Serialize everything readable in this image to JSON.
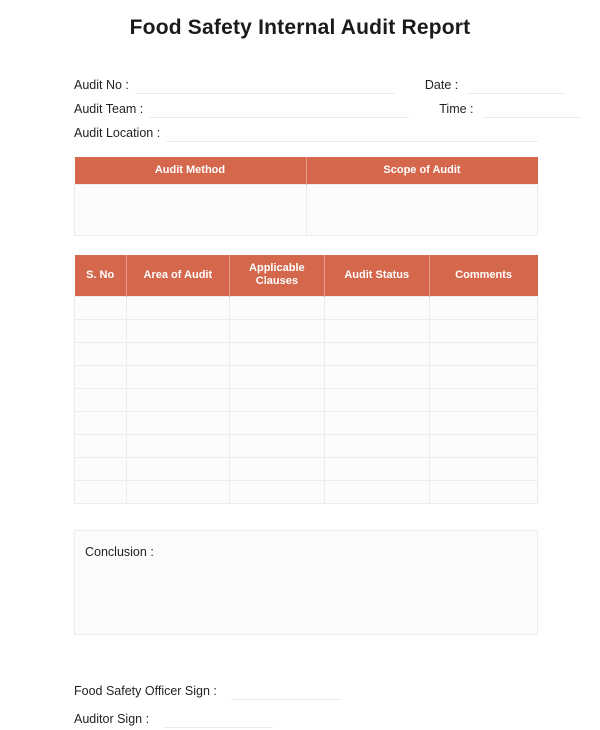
{
  "document": {
    "title": "Food Safety Internal Audit Report"
  },
  "meta": {
    "audit_no_label": "Audit No :",
    "audit_team_label": "Audit Team :",
    "audit_location_label": "Audit Location :",
    "date_label": "Date :",
    "time_label": "Time :",
    "audit_no_value": "",
    "audit_team_value": "",
    "audit_location_value": "",
    "date_value": "",
    "time_value": ""
  },
  "method_table": {
    "headers": [
      "Audit Method",
      "Scope of Audit"
    ],
    "rows": [
      [
        "",
        ""
      ]
    ]
  },
  "findings_table": {
    "headers": [
      "S. No",
      "Area of Audit",
      "Applicable Clauses",
      "Audit Status",
      "Comments"
    ],
    "rows": [
      [
        "",
        "",
        "",
        "",
        ""
      ],
      [
        "",
        "",
        "",
        "",
        ""
      ],
      [
        "",
        "",
        "",
        "",
        ""
      ],
      [
        "",
        "",
        "",
        "",
        ""
      ],
      [
        "",
        "",
        "",
        "",
        ""
      ],
      [
        "",
        "",
        "",
        "",
        ""
      ],
      [
        "",
        "",
        "",
        "",
        ""
      ],
      [
        "",
        "",
        "",
        "",
        ""
      ],
      [
        "",
        "",
        "",
        "",
        ""
      ]
    ]
  },
  "conclusion": {
    "label": "Conclusion :",
    "value": ""
  },
  "signatures": {
    "officer_label": "Food Safety Officer Sign :",
    "officer_value": "",
    "auditor_label": "Auditor Sign :",
    "auditor_value": ""
  },
  "colors": {
    "header_fill": "#d4674c",
    "header_text": "#ffffff",
    "cell_fill": "#fcfcfc",
    "cell_border": "#ececec",
    "rule": "#ebebeb",
    "page_background": "#ffffff",
    "body_text": "#231f20"
  }
}
